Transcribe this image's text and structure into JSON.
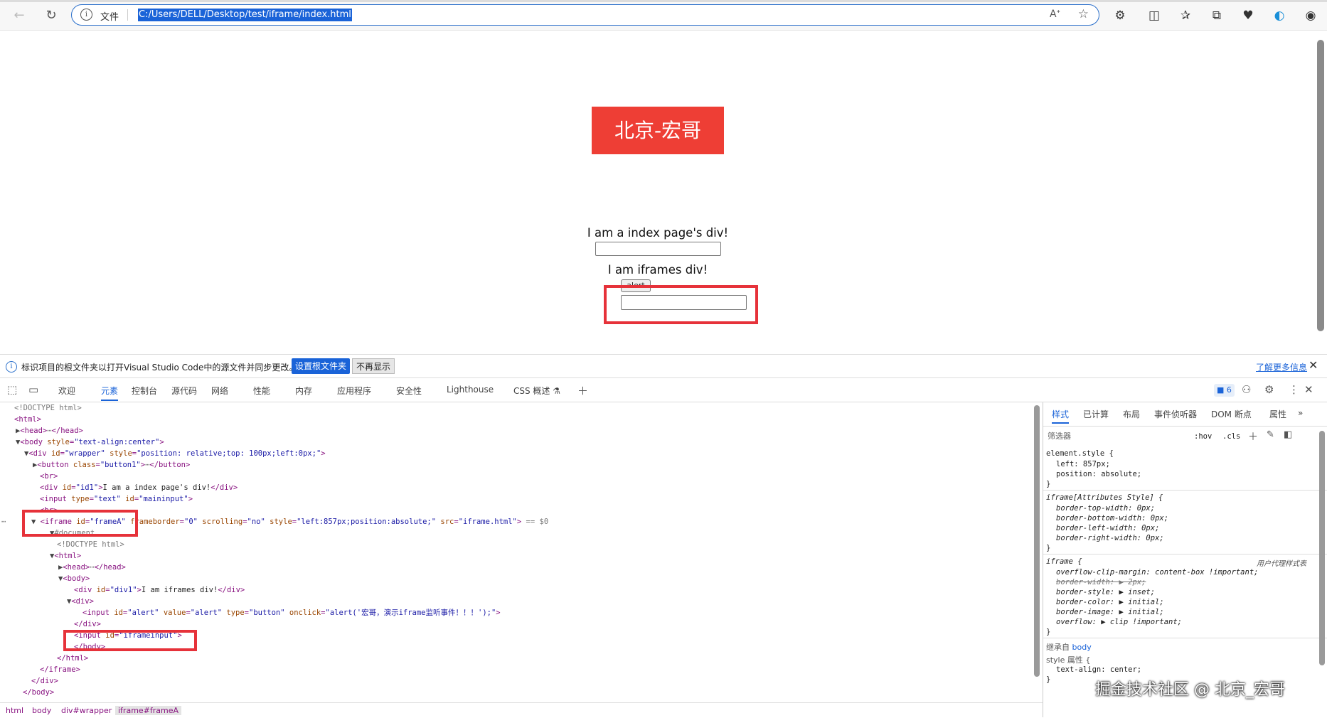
{
  "browser": {
    "address_label": "文件",
    "url": "C:/Users/DELL/Desktop/test/iframe/index.html"
  },
  "page": {
    "title_button": "北京-宏哥",
    "index_div_text": "I am a index page's div!",
    "iframe_div_text": "I am iframes div!",
    "alert_button_label": "alert"
  },
  "infobar": {
    "message": "标识项目的根文件夹以打开Visual Studio Code中的源文件并同步更改。",
    "set_root_button": "设置根文件夹",
    "dont_show_button": "不再显示",
    "learn_more": "了解更多信息"
  },
  "devtools": {
    "tabs": [
      "欢迎",
      "元素",
      "控制台",
      "源代码",
      "网络",
      "性能",
      "内存",
      "应用程序",
      "安全性",
      "Lighthouse",
      "CSS 概述 ⚗"
    ],
    "issues_count": "6",
    "breadcrumbs": [
      "html",
      "body",
      "div#wrapper",
      "iframe#frameA"
    ],
    "styles_tabs": [
      "样式",
      "已计算",
      "布局",
      "事件侦听器",
      "DOM 断点",
      "属性"
    ],
    "filter_placeholder": "筛选器",
    "hov": ":hov",
    "cls": ".cls",
    "element_style_selector": "element.style {",
    "element_style_props": [
      "left: 857px;",
      "position: absolute;"
    ],
    "iframe_attr_selector": "iframe[Attributes Style] {",
    "iframe_attr_props": [
      "border-top-width: 0px;",
      "border-bottom-width: 0px;",
      "border-left-width: 0px;",
      "border-right-width: 0px;"
    ],
    "iframe_selector": "iframe {",
    "ua_label": "用户代理样式表",
    "iframe_props": [
      "overflow-clip-margin: content-box !important;",
      "border-width: ▶ 2px;",
      "border-style: ▶ inset;",
      "border-color: ▶ initial;",
      "border-image: ▶ initial;",
      "overflow: ▶ clip !important;"
    ],
    "inherited_label": "继承自",
    "inherited_from": "body",
    "style_attr_label": "style 属性 {",
    "style_attr_prop": "text-align: center;",
    "close_brace": "}"
  },
  "watermark": "掘金技术社区 @ 北京_宏哥"
}
